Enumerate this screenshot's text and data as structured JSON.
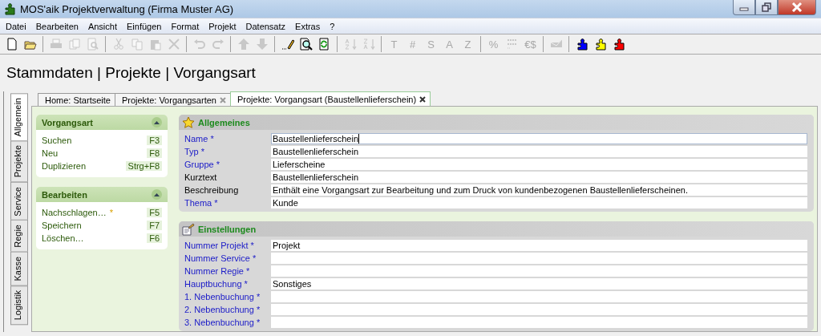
{
  "window": {
    "title": "MOS'aik Projektverwaltung (Firma Muster AG)"
  },
  "menu": [
    "Datei",
    "Bearbeiten",
    "Ansicht",
    "Einfügen",
    "Format",
    "Projekt",
    "Datensatz",
    "Extras",
    "?"
  ],
  "toolbar": [
    [
      {
        "kind": "icon",
        "disabled": false
      },
      {
        "kind": "icon",
        "disabled": false
      }
    ],
    [
      {
        "kind": "icon",
        "disabled": true
      },
      {
        "kind": "icon",
        "disabled": true
      },
      {
        "kind": "icon",
        "disabled": true
      }
    ],
    [
      {
        "kind": "icon",
        "disabled": true
      },
      {
        "kind": "icon",
        "disabled": true
      },
      {
        "kind": "icon",
        "disabled": true
      },
      {
        "kind": "icon",
        "disabled": true
      }
    ],
    [
      {
        "kind": "icon",
        "disabled": true
      },
      {
        "kind": "icon",
        "disabled": true
      }
    ],
    [
      {
        "kind": "icon",
        "disabled": true
      },
      {
        "kind": "icon",
        "disabled": true
      }
    ],
    [
      {
        "kind": "icon",
        "disabled": false
      },
      {
        "kind": "icon",
        "disabled": false
      },
      {
        "kind": "icon",
        "disabled": false
      }
    ],
    [
      {
        "kind": "icon",
        "disabled": true
      },
      {
        "kind": "icon",
        "disabled": true
      }
    ],
    [
      {
        "kind": "glyph",
        "label": "T",
        "disabled": true
      },
      {
        "kind": "glyph",
        "label": "#",
        "disabled": true
      },
      {
        "kind": "glyph",
        "label": "S",
        "disabled": true
      },
      {
        "kind": "glyph",
        "label": "A",
        "disabled": true
      },
      {
        "kind": "glyph",
        "label": "Z",
        "disabled": true
      }
    ],
    [
      {
        "kind": "glyph",
        "label": "%",
        "disabled": true
      },
      {
        "kind": "icon",
        "disabled": true
      },
      {
        "kind": "glyph",
        "label": "€$",
        "disabled": true
      }
    ],
    [
      {
        "kind": "icon",
        "disabled": true
      }
    ],
    [
      {
        "kind": "icon",
        "disabled": false,
        "color": "#0000ff"
      },
      {
        "kind": "icon",
        "disabled": false,
        "color": "#ffff00"
      },
      {
        "kind": "icon",
        "disabled": false,
        "color": "#ff0000"
      }
    ]
  ],
  "heading": "Stammdaten | Projekte | Vorgangsart",
  "side_tabs": [
    {
      "label": "Allgemein",
      "selected": true
    },
    {
      "label": "Projekte",
      "selected": false
    },
    {
      "label": "Service",
      "selected": false
    },
    {
      "label": "Regie",
      "selected": false
    },
    {
      "label": "Kasse",
      "selected": false
    },
    {
      "label": "Logistik",
      "selected": false
    }
  ],
  "tabs": [
    {
      "label": "Home: Startseite",
      "selected": false,
      "closable": false
    },
    {
      "label": "Projekte: Vorgangsarten",
      "selected": false,
      "closable": true
    },
    {
      "label": "Projekte: Vorgangsart (Baustellenlieferschein)",
      "selected": true,
      "closable": true
    }
  ],
  "task_panels": [
    {
      "title": "Vorgangsart",
      "expanded": true,
      "items": [
        {
          "label": "Suchen",
          "shortcut": "F3"
        },
        {
          "label": "Neu",
          "shortcut": "F8"
        },
        {
          "label": "Duplizieren",
          "shortcut": "Strg+F8"
        }
      ]
    },
    {
      "title": "Bearbeiten",
      "expanded": true,
      "items": [
        {
          "label": "Nachschlagen…",
          "marker": "*",
          "shortcut": "F5"
        },
        {
          "label": "Speichern",
          "shortcut": "F7"
        },
        {
          "label": "Löschen…",
          "shortcut": "F6"
        }
      ]
    }
  ],
  "sections": [
    {
      "title": "Allgemeines",
      "kind": "star",
      "fields": [
        {
          "label": "Name *",
          "required": true,
          "value": "Baustellenlieferschein",
          "focused": true
        },
        {
          "label": "Typ *",
          "required": true,
          "value": "Baustellenlieferschein",
          "focused": false
        },
        {
          "label": "Gruppe *",
          "required": true,
          "value": "Lieferscheine",
          "focused": false
        },
        {
          "label": "Kurztext",
          "required": false,
          "value": "Baustellenlieferschein",
          "focused": false
        },
        {
          "label": "Beschreibung",
          "required": false,
          "value": "Enthält eine Vorgangsart zur Bearbeitung und zum Druck von kundenbezogenen Baustellenlieferscheinen.",
          "focused": false
        },
        {
          "label": "Thema *",
          "required": true,
          "value": "Kunde",
          "focused": false
        }
      ]
    },
    {
      "title": "Einstellungen",
      "kind": "settings",
      "fields": [
        {
          "label": "Nummer Projekt *",
          "required": true,
          "value": "Projekt",
          "focused": false
        },
        {
          "label": "Nummer Service *",
          "required": true,
          "focused": false
        },
        {
          "label": "Nummer Regie *",
          "required": true,
          "focused": false
        },
        {
          "label": "Hauptbuchung *",
          "required": true,
          "value": "Sonstiges",
          "focused": false
        },
        {
          "label": "1. Nebenbuchung *",
          "required": true,
          "focused": false
        },
        {
          "label": "2. Nebenbuchung *",
          "required": true,
          "focused": false
        },
        {
          "label": "3. Nebenbuchung *",
          "required": true,
          "focused": false
        }
      ]
    }
  ]
}
